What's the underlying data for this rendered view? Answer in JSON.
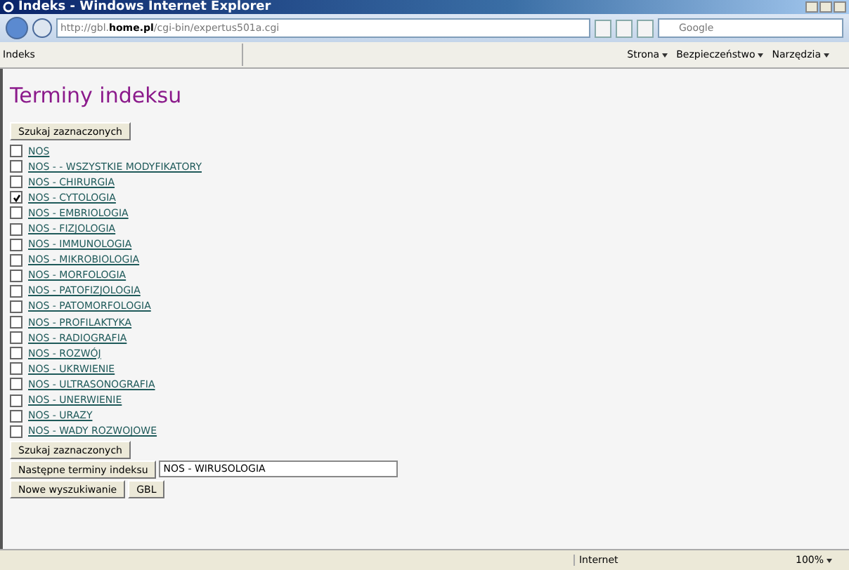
{
  "window": {
    "title": "Indeks - Windows Internet Explorer"
  },
  "address_bar": {
    "url_prefix": "http://gbl.",
    "url_host": "home.pl",
    "url_path": "/cgi-bin/expertus501a.cgi"
  },
  "search": {
    "placeholder": "Google"
  },
  "tab": {
    "label": "Indeks"
  },
  "command_bar": [
    "Strona",
    "Bezpieczeństwo",
    "Narzędzia"
  ],
  "page": {
    "heading": "Terminy indeksu",
    "search_top": "Szukaj zaznaczonych",
    "items": [
      {
        "label": "NOS",
        "checked": false
      },
      {
        "label": "NOS - - WSZYSTKIE MODYFIKATORY",
        "checked": false
      },
      {
        "label": "NOS - CHIRURGIA",
        "checked": false
      },
      {
        "label": "NOS - CYTOLOGIA",
        "checked": true
      },
      {
        "label": "NOS - EMBRIOLOGIA",
        "checked": false
      },
      {
        "label": "NOS - FIZJOLOGIA",
        "checked": false
      },
      {
        "label": "NOS - IMMUNOLOGIA",
        "checked": false
      },
      {
        "label": "NOS - MIKROBIOLOGIA",
        "checked": false
      },
      {
        "label": "NOS - MORFOLOGIA",
        "checked": false
      },
      {
        "label": "NOS - PATOFIZJOLOGIA",
        "checked": false
      },
      {
        "label": "NOS - PATOMORFOLOGIA",
        "checked": false
      },
      {
        "label": "NOS - PROFILAKTYKA",
        "checked": false
      },
      {
        "label": "NOS - RADIOGRAFIA",
        "checked": false
      },
      {
        "label": "NOS - ROZWÓJ",
        "checked": false
      },
      {
        "label": "NOS - UKRWIENIE",
        "checked": false
      },
      {
        "label": "NOS - ULTRASONOGRAFIA",
        "checked": false
      },
      {
        "label": "NOS - UNERWIENIE",
        "checked": false
      },
      {
        "label": "NOS - URAZY",
        "checked": false
      },
      {
        "label": "NOS - WADY ROZWOJOWE",
        "checked": false
      }
    ],
    "search_bottom": "Szukaj zaznaczonych",
    "next_button": "Następne terminy indeksu",
    "next_value": "NOS - WIRUSOLOGIA",
    "new_search": "Nowe wyszukiwanie",
    "gbl": "GBL"
  },
  "status_bar": {
    "zone": "Internet",
    "zoom": "100%"
  }
}
